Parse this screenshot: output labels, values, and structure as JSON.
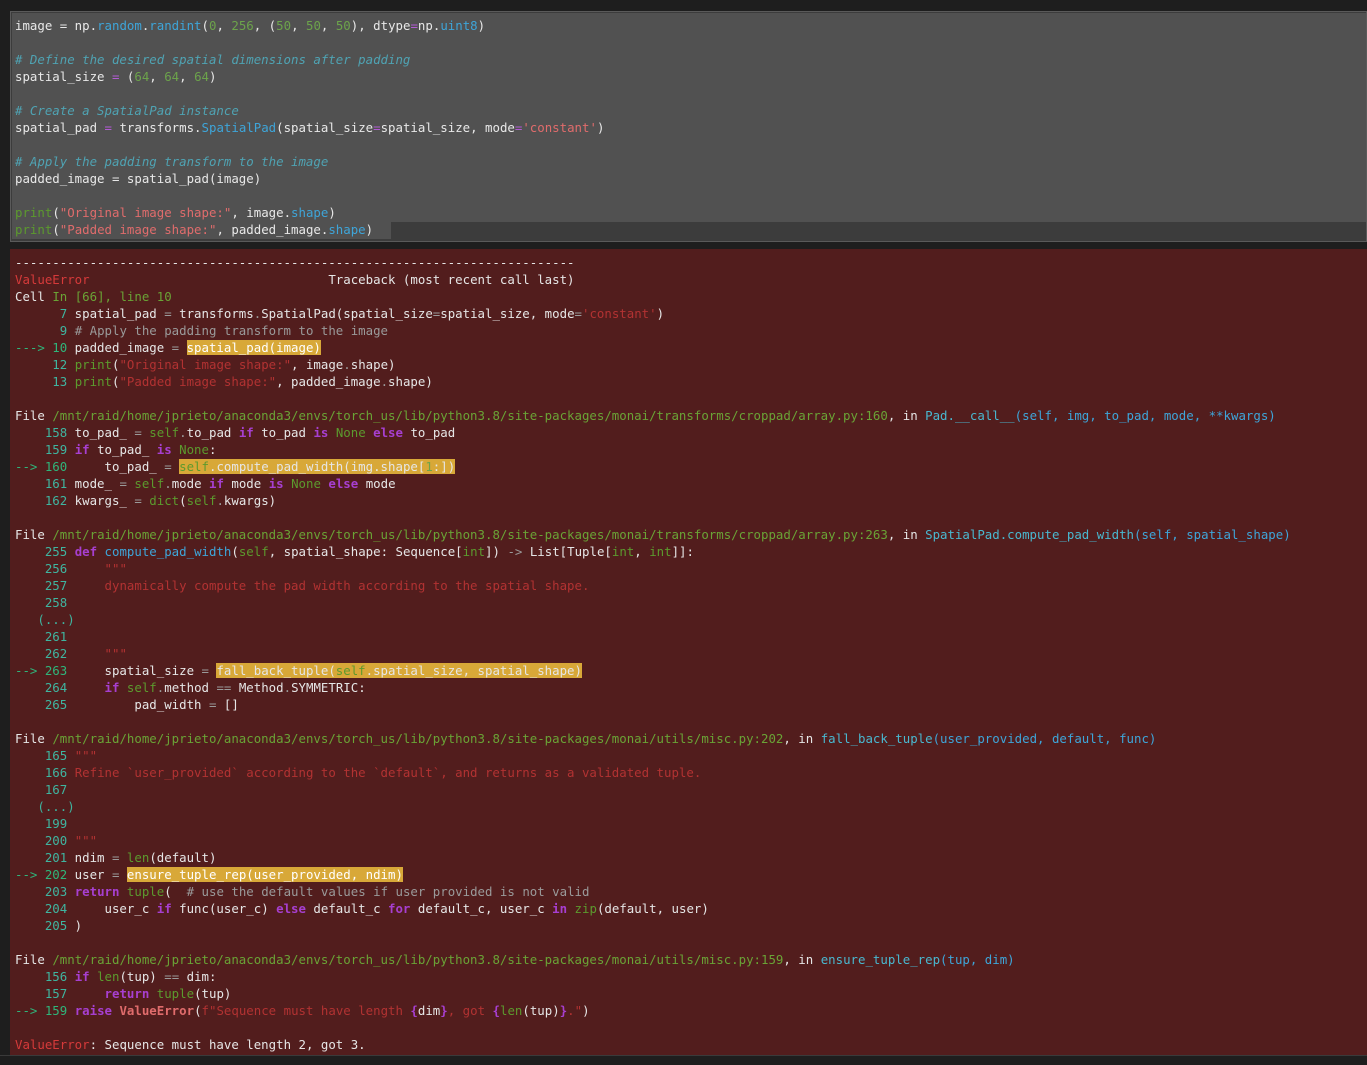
{
  "input_cell": {
    "lines": [
      "image = np.random.randint(0, 256, (50, 50, 50), dtype=np.uint8)",
      "",
      "# Define the desired spatial dimensions after padding",
      "spatial_size = (64, 64, 64)",
      "",
      "# Create a SpatialPad instance",
      "spatial_pad = transforms.SpatialPad(spatial_size=spatial_size, mode='constant')",
      "",
      "# Apply the padding transform to the image",
      "padded_image = spatial_pad(image)",
      "",
      "print(\"Original image shape:\", image.shape)",
      "print(\"Padded image shape:\", padded_image.shape)"
    ]
  },
  "traceback": {
    "separator": "---------------------------------------------------------------------------",
    "error_type": "ValueError",
    "header": "Traceback (most recent call last)",
    "cell_ref": "Cell In [66], line 10",
    "final_error_type": "ValueError",
    "final_error_msg": ": Sequence must have length 2, got 3."
  },
  "colors": {
    "input_bg": "#3c3c3c",
    "output_bg": "#521d1d",
    "highlight": "#d8a838"
  }
}
